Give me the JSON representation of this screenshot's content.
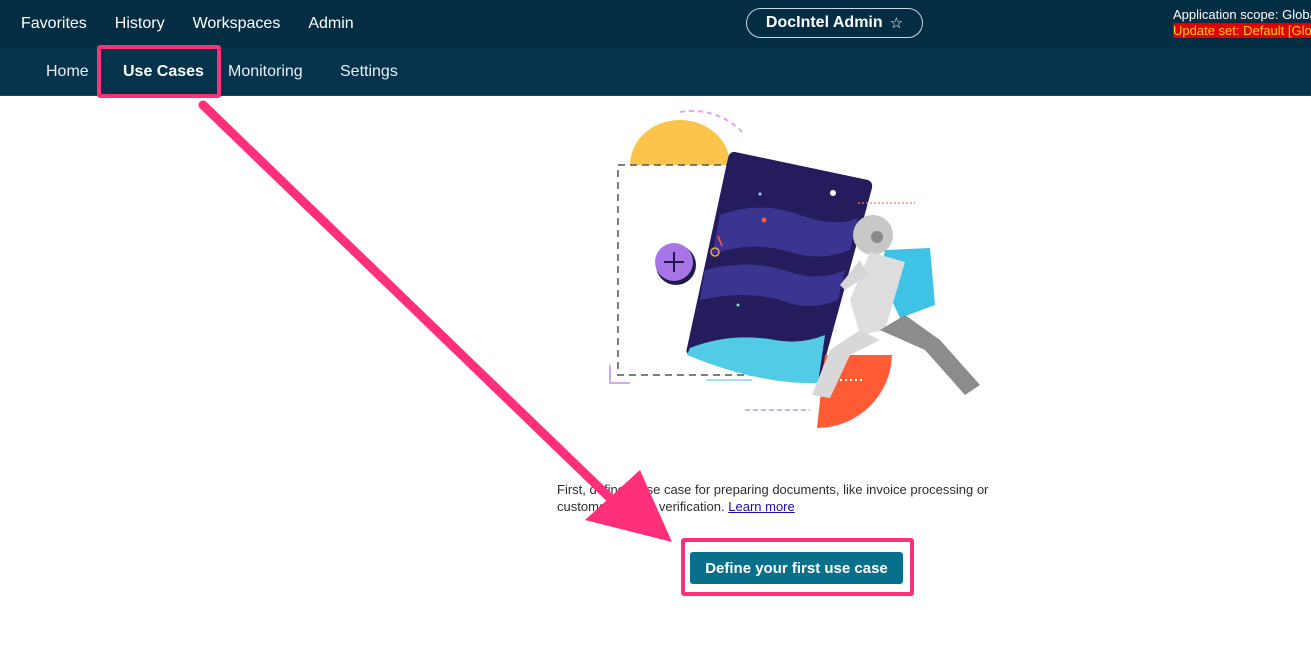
{
  "topbar": {
    "menu": [
      "Favorites",
      "History",
      "Workspaces",
      "Admin"
    ],
    "app_name": "DocIntel Admin",
    "favorite_icon": "star-outline-icon",
    "scope_label": "Application scope: Globa",
    "update_set_label": "Update set: Default [Glo"
  },
  "subnav": {
    "tabs": [
      {
        "label": "Home",
        "active": false
      },
      {
        "label": "Use Cases",
        "active": true
      },
      {
        "label": "Monitoring",
        "active": false
      },
      {
        "label": "Settings",
        "active": false
      }
    ]
  },
  "empty_state": {
    "illustration": "astronaut-document-illustration",
    "description_line1": "First, define a use case for preparing documents, like invoice processing or",
    "description_line2": "customer identity verification.",
    "learn_more": "Learn more",
    "cta_label": "Define your first use case"
  },
  "annotations": {
    "highlight_color": "#ff2f7b",
    "arrow_color": "#ff2f7b"
  },
  "colors": {
    "topbar_bg": "#032d42",
    "subnav_bg": "#04334b",
    "button_bg": "#08708a",
    "update_set_bg": "#e00000",
    "update_set_text": "#ffd400"
  }
}
